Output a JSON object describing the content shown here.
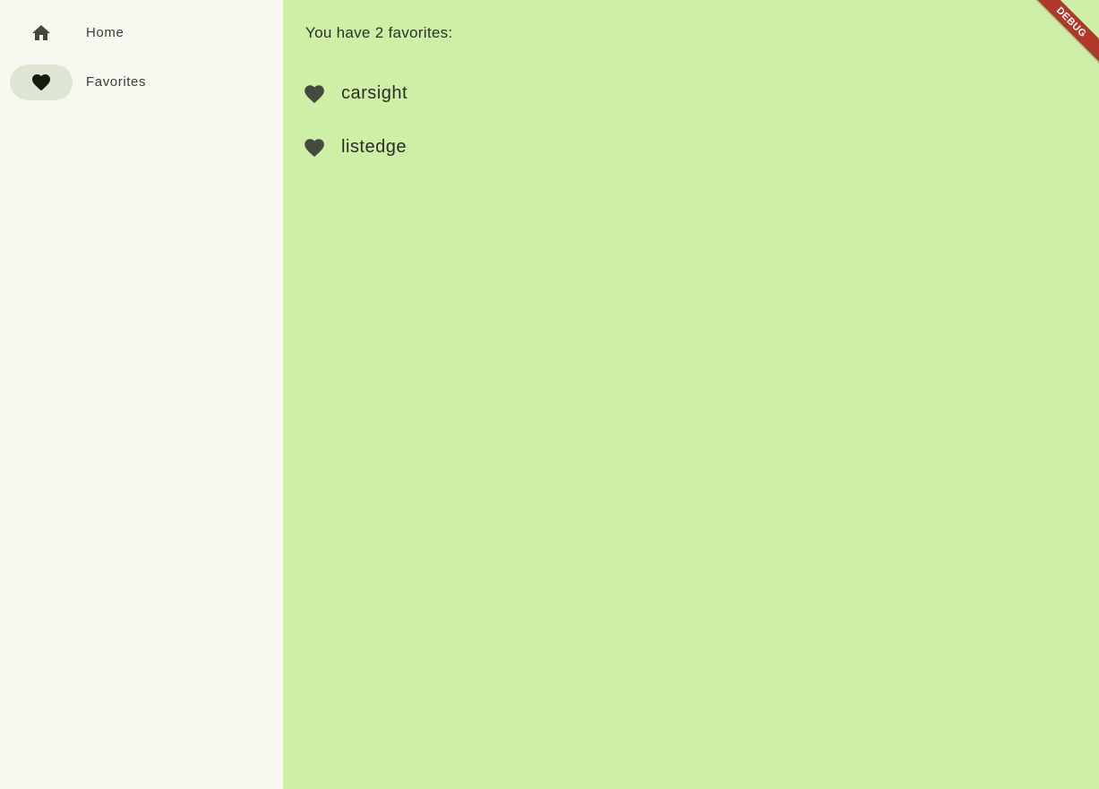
{
  "navigation": {
    "items": [
      {
        "label": "Home",
        "icon": "home-icon",
        "selected": false
      },
      {
        "label": "Favorites",
        "icon": "heart-icon",
        "selected": true
      }
    ]
  },
  "main": {
    "favorites_count_text": "You have 2 favorites:",
    "favorites": [
      {
        "text": "carsight",
        "icon": "heart-icon"
      },
      {
        "text": "listedge",
        "icon": "heart-icon"
      }
    ]
  },
  "debug_banner": {
    "label": "DEBUG"
  },
  "colors": {
    "rail_background": "#f8f8f1",
    "content_background": "#cdefa6",
    "selected_indicator": "#dfe7d4",
    "banner": "#b0392c"
  }
}
